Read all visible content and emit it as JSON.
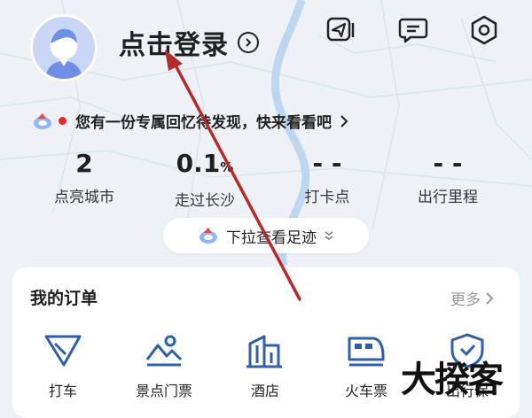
{
  "header": {
    "login_label": "点击登录",
    "icons": [
      "share-icon",
      "message-icon",
      "settings-icon"
    ]
  },
  "promo": {
    "text": "您有一份专属回忆待发现，快来看看吧"
  },
  "stats": [
    {
      "value": "2",
      "unit": "",
      "label": "点亮城市"
    },
    {
      "value": "0.1",
      "unit": "%",
      "label": "走过长沙"
    },
    {
      "value": "- -",
      "unit": "",
      "label": "打卡点"
    },
    {
      "value": "- -",
      "unit": "",
      "label": "出行里程"
    }
  ],
  "pull_down": {
    "label": "下拉查看足迹"
  },
  "orders": {
    "title": "我的订单",
    "more_label": "更多",
    "services": [
      {
        "label": "打车",
        "icon": "taxi-icon"
      },
      {
        "label": "景点门票",
        "icon": "scenic-ticket-icon"
      },
      {
        "label": "酒店",
        "icon": "hotel-icon"
      },
      {
        "label": "火车票",
        "icon": "train-icon"
      },
      {
        "label": "出行保",
        "icon": "insurance-icon"
      }
    ]
  },
  "watermark": {
    "text": "大揆客"
  },
  "colors": {
    "accent_red": "#e02b2b",
    "annotation_arrow": "#b52a2a",
    "icon_blue": "#2f5fa8"
  }
}
